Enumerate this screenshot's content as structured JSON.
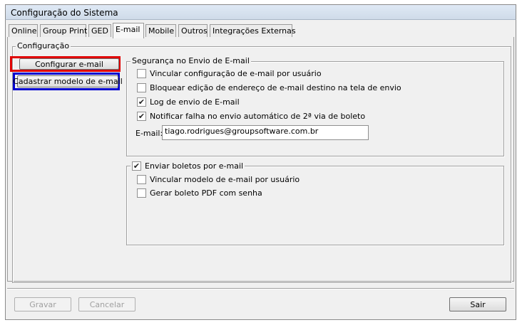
{
  "window": {
    "title": "Configuração do Sistema"
  },
  "tabs": [
    "Online",
    "Group Print",
    "GED",
    "E-mail",
    "Mobile",
    "Outros",
    "Integrações Externas"
  ],
  "active_tab": "E-mail",
  "config_group": {
    "legend": "Configuração",
    "buttons": [
      "Configurar e-mail",
      "Cadastrar modelo de e-mail"
    ]
  },
  "security_group": {
    "legend": "Segurança no Envio de E-mail",
    "options": [
      {
        "label": "Vincular configuração de e-mail por usuário",
        "checked": false
      },
      {
        "label": "Bloquear edição de endereço de e-mail destino na tela de envio",
        "checked": false
      },
      {
        "label": "Log de envio de E-mail",
        "checked": true
      },
      {
        "label": "Notificar falha no envio automático de 2ª via de boleto",
        "checked": true
      }
    ],
    "email_label": "E-mail:",
    "email_value": "tiago.rodrigues@groupsoftware.com.br"
  },
  "boletos_group": {
    "legend": "Enviar boletos por e-mail",
    "legend_checked": true,
    "options": [
      {
        "label": "Vincular modelo de e-mail por usuário",
        "checked": false
      },
      {
        "label": "Gerar boleto PDF com senha",
        "checked": false
      }
    ]
  },
  "footer": {
    "save": "Gravar",
    "cancel": "Cancelar",
    "exit": "Sair"
  },
  "colors": {
    "highlight_red": "#e00000",
    "highlight_blue": "#0000d0",
    "window_bg": "#f0f0f0"
  },
  "icons": {
    "check": "checkmark-icon"
  }
}
